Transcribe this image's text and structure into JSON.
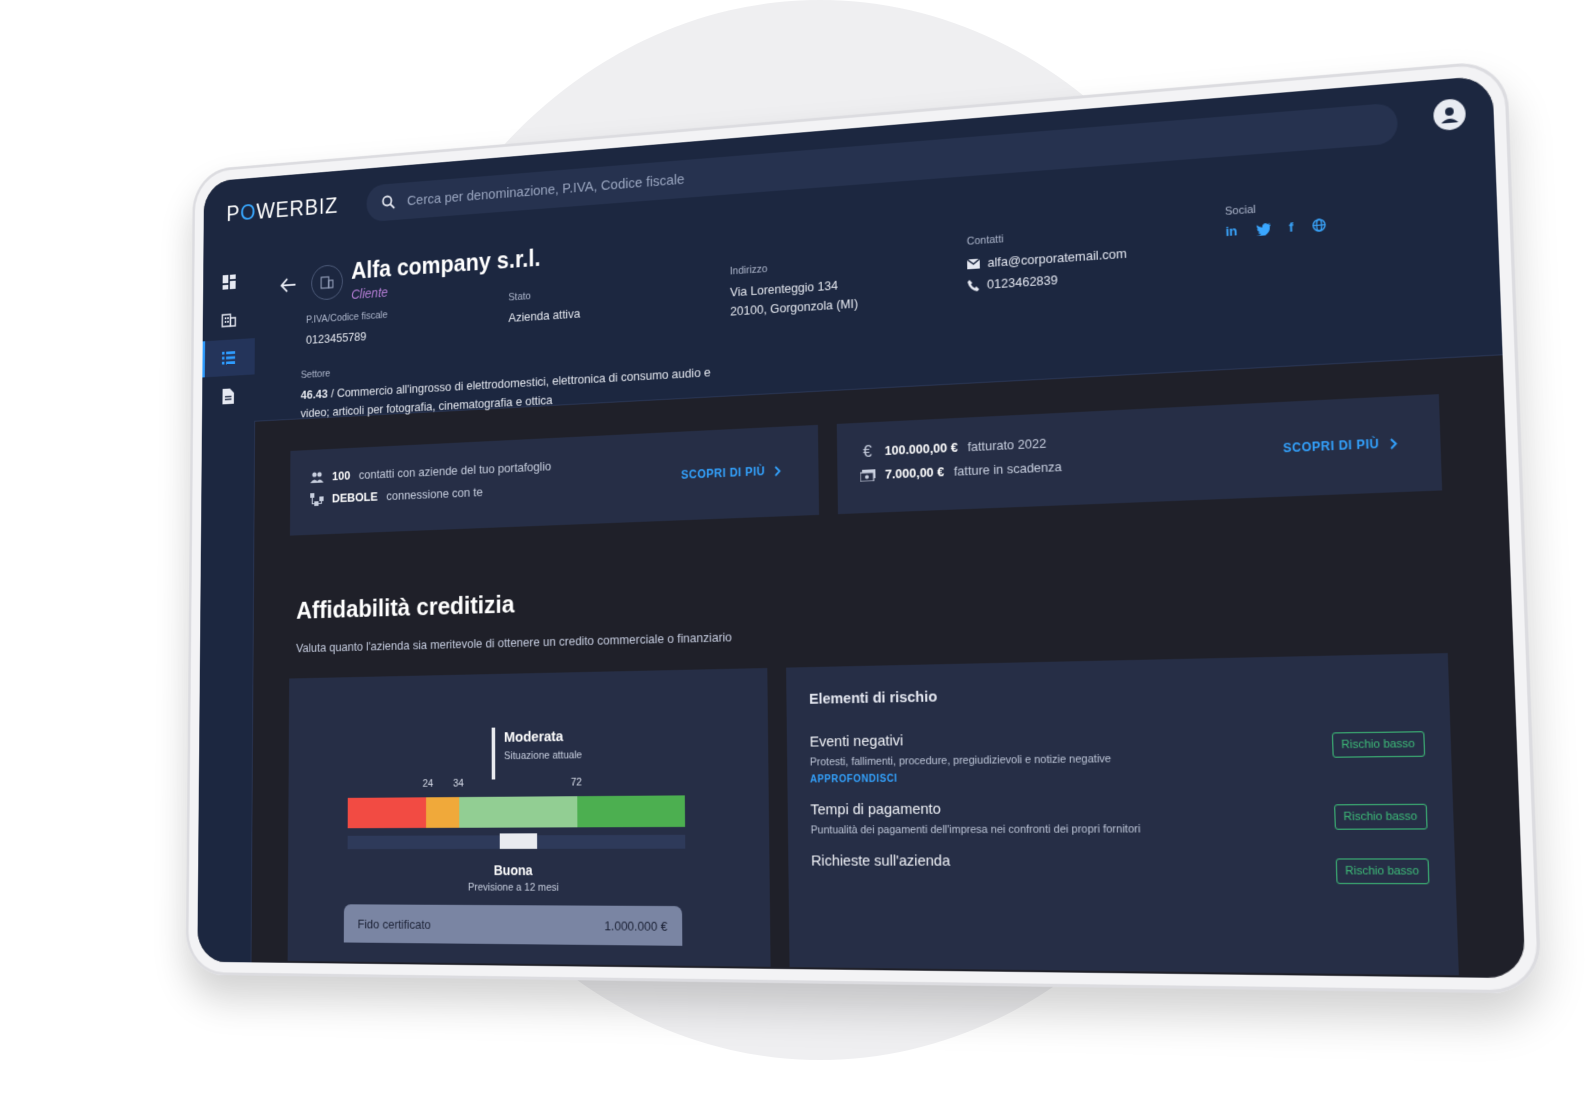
{
  "app": {
    "logo": "POWERBIZ"
  },
  "search": {
    "placeholder": "Cerca per denominazione, P.IVA, Codice fiscale"
  },
  "company": {
    "name": "Alfa company s.r.l.",
    "role": "Cliente",
    "piva_label": "P.IVA/Codice fiscale",
    "piva": "0123455789",
    "stato_label": "Stato",
    "stato": "Azienda attiva",
    "indirizzo_label": "Indirizzo",
    "indirizzo_1": "Via Lorenteggio 134",
    "indirizzo_2": "20100, Gorgonzola (MI)",
    "contatti_label": "Contatti",
    "email": "alfa@corporatemail.com",
    "phone": "0123462839",
    "social_label": "Social",
    "settore_label": "Settore",
    "settore_code": "46.43",
    "settore_text": " / Commercio all'ingrosso di elettrodomestici, elettronica di consumo audio e video; articoli per fotografia, cinematografia e ottica"
  },
  "cards": {
    "contacts_count": "100",
    "contacts_text": "contatti con aziende del tuo portafoglio",
    "connection_level": "DEBOLE",
    "connection_text": "connessione con te",
    "more_label": "SCOPRI DI PIÙ",
    "revenue": "100.000,00 €",
    "revenue_text": "fatturato 2022",
    "invoices": "7.000,00 €",
    "invoices_text": "fatture in scadenza"
  },
  "credit": {
    "title": "Affidabilità creditizia",
    "subtitle": "Valuta quanto l'azienda sia meritevole di ottenere un credito commerciale o finanziario",
    "current_label": "Moderata",
    "current_sub": "Situazione attuale",
    "tick_24": "24",
    "tick_34": "34",
    "tick_72": "72",
    "pred_label": "Buona",
    "pred_sub": "Previsione a 12 mesi",
    "fido_label": "Fido certificato",
    "fido_value": "1.000.000 €"
  },
  "risk": {
    "title": "Elementi di rischio",
    "items": [
      {
        "name": "Eventi negativi",
        "desc": "Protesti, fallimenti, procedure, pregiudizievoli e notizie negative",
        "link": "APPROFONDISCI",
        "badge": "Rischio basso"
      },
      {
        "name": "Tempi di pagamento",
        "desc": "Puntualità dei pagamenti dell'impresa nei confronti dei propri fornitori",
        "badge": "Rischio basso"
      },
      {
        "name": "Richieste sull'azienda",
        "badge": "Rischio basso"
      }
    ]
  },
  "colors": {
    "gauge_red": "#f24b43",
    "gauge_orange": "#f0a93a",
    "gauge_light_green": "#92ce93",
    "gauge_green": "#4caf50",
    "accent": "#33a3ff"
  }
}
